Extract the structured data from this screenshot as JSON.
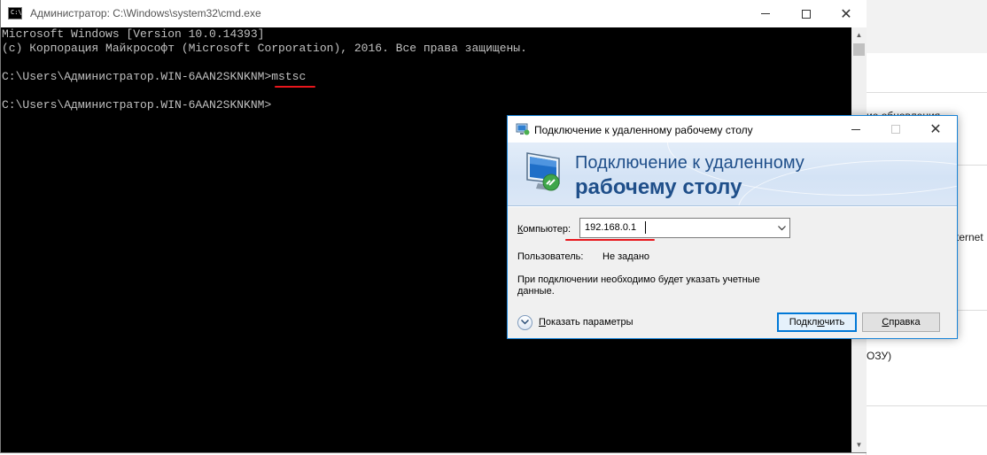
{
  "background_window": {
    "fragments": [
      "ие обновления",
      "ternet",
      "ОЗУ)"
    ]
  },
  "cmd": {
    "title": "Администратор: C:\\Windows\\system32\\cmd.exe",
    "icon_label": "C:\\",
    "lines": [
      "Microsoft Windows [Version 10.0.14393]",
      "(c) Корпорация Майкрософт (Microsoft Corporation), 2016. Все права защищены.",
      "",
      "C:\\Users\\Администратор.WIN-6AAN2SKNKNM>mstsc",
      "",
      "C:\\Users\\Администратор.WIN-6AAN2SKNKNM>"
    ],
    "controls": {
      "minimize": "minimize",
      "maximize": "maximize",
      "close": "✕"
    }
  },
  "rdp": {
    "title": "Подключение к удаленному рабочему столу",
    "banner_line1": "Подключение к удаленному",
    "banner_line2": "рабочему столу",
    "computer_label_pre": "",
    "computer_label_hotkey": "К",
    "computer_label_post": "омпьютер:",
    "computer_value": "192.168.0.1",
    "user_label": "Пользователь:",
    "user_value": "Не задано",
    "info_text": "При подключении необходимо будет указать учетные данные.",
    "show_params_label_pre": "",
    "show_params_hotkey": "П",
    "show_params_label_post": "оказать параметры",
    "connect_label_pre": "Подкл",
    "connect_hotkey": "ю",
    "connect_label_post": "чить",
    "help_label_pre": "",
    "help_hotkey": "С",
    "help_label_post": "правка",
    "close_glyph": "✕"
  },
  "icons": [
    "cmd-app-icon",
    "rdp-app-icon",
    "remote-desktop-monitor-icon",
    "chevron-down-icon",
    "expand-options-icon",
    "close-icon",
    "minimize-icon",
    "maximize-icon"
  ],
  "colors": {
    "highlight_underline": "#e8161c",
    "dialog_border": "#1883d7",
    "banner_text": "#1f4f8a",
    "console_text": "#c0c0c0",
    "console_bg": "#000000"
  }
}
